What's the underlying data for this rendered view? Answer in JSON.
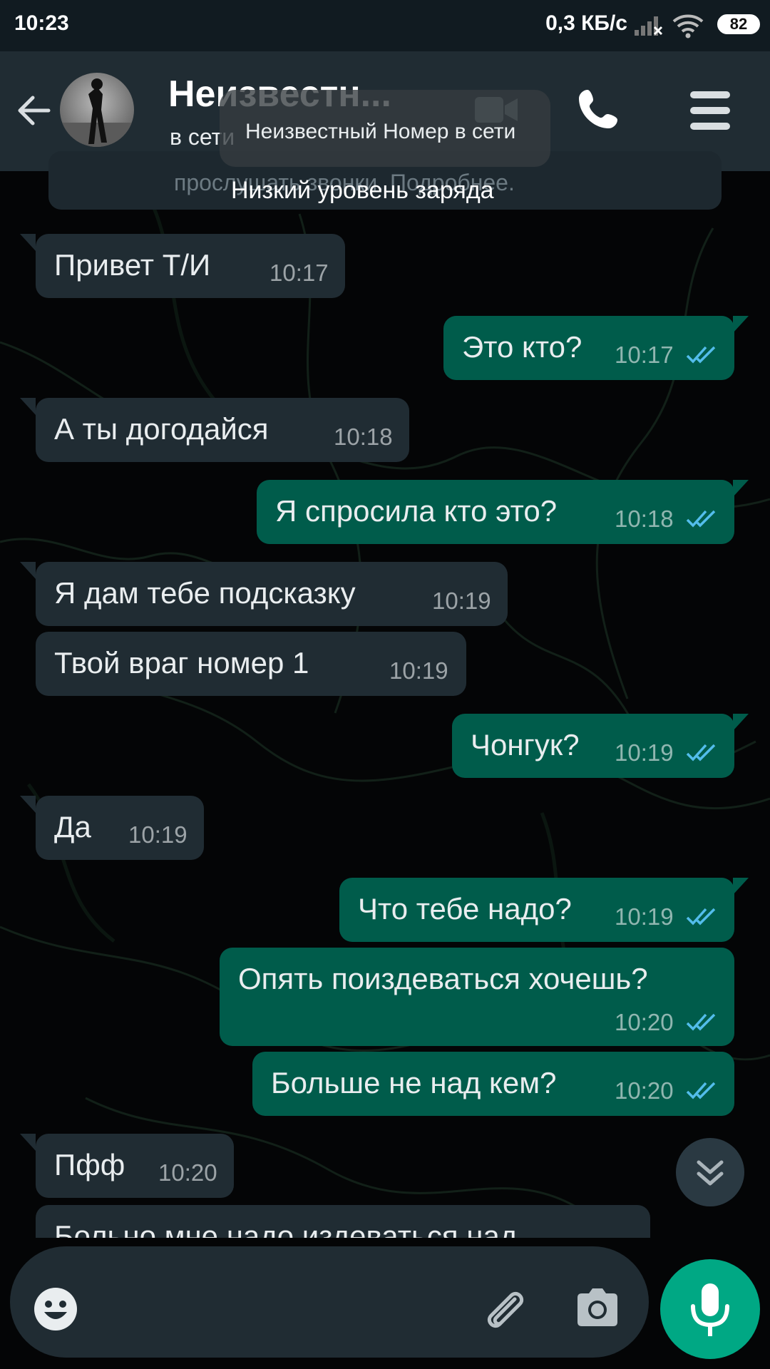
{
  "status_bar": {
    "time": "10:23",
    "net_speed": "0,3 КБ/с",
    "battery": "82"
  },
  "header": {
    "title": "Неизвестн...",
    "subtitle": "в сети",
    "back_icon": "arrow-left-icon",
    "video_icon": "video-camera-icon",
    "call_icon": "phone-icon",
    "menu_icon": "menu-icon"
  },
  "tooltip": {
    "text": "Неизвестный Номер в сети"
  },
  "notice": {
    "text": "прослушать звонки. Подробнее."
  },
  "toast": {
    "text": "Низкий уровень заряда"
  },
  "messages": [
    {
      "direction": "in",
      "text": "Привет Т/И",
      "time": "10:17"
    },
    {
      "direction": "out",
      "text": "Это кто?",
      "time": "10:17",
      "status": "read"
    },
    {
      "direction": "in",
      "text": "А ты догодайся",
      "time": "10:18"
    },
    {
      "direction": "out",
      "text": "Я спросила кто это?",
      "time": "10:18",
      "status": "read"
    },
    {
      "direction": "in",
      "text": "Я дам тебе подсказку",
      "time": "10:19"
    },
    {
      "direction": "in",
      "text": "Твой враг  номер 1",
      "time": "10:19"
    },
    {
      "direction": "out",
      "text": "Чонгук?",
      "time": "10:19",
      "status": "read"
    },
    {
      "direction": "in",
      "text": "Да",
      "time": "10:19"
    },
    {
      "direction": "out",
      "text": "Что тебе надо?",
      "time": "10:19",
      "status": "read"
    },
    {
      "direction": "out",
      "text": "Опять поиздеваться хочешь?",
      "time": "10:20",
      "status": "read"
    },
    {
      "direction": "out",
      "text": "Больше не над кем?",
      "time": "10:20",
      "status": "read"
    },
    {
      "direction": "in",
      "text": "Пфф",
      "time": "10:20"
    },
    {
      "direction": "in",
      "text": "Больно мне надо издеваться над",
      "time": ""
    }
  ],
  "composer": {
    "emoji_icon": "smiley-icon",
    "attach_icon": "paperclip-icon",
    "camera_icon": "camera-icon",
    "mic_icon": "microphone-icon",
    "scroll_icon": "double-chevron-down-icon"
  },
  "colors": {
    "header_bg": "#202c33",
    "incoming_bubble": "#202c33",
    "outgoing_bubble": "#005c4b",
    "read_ticks": "#53bdeb",
    "accent": "#00a884"
  }
}
